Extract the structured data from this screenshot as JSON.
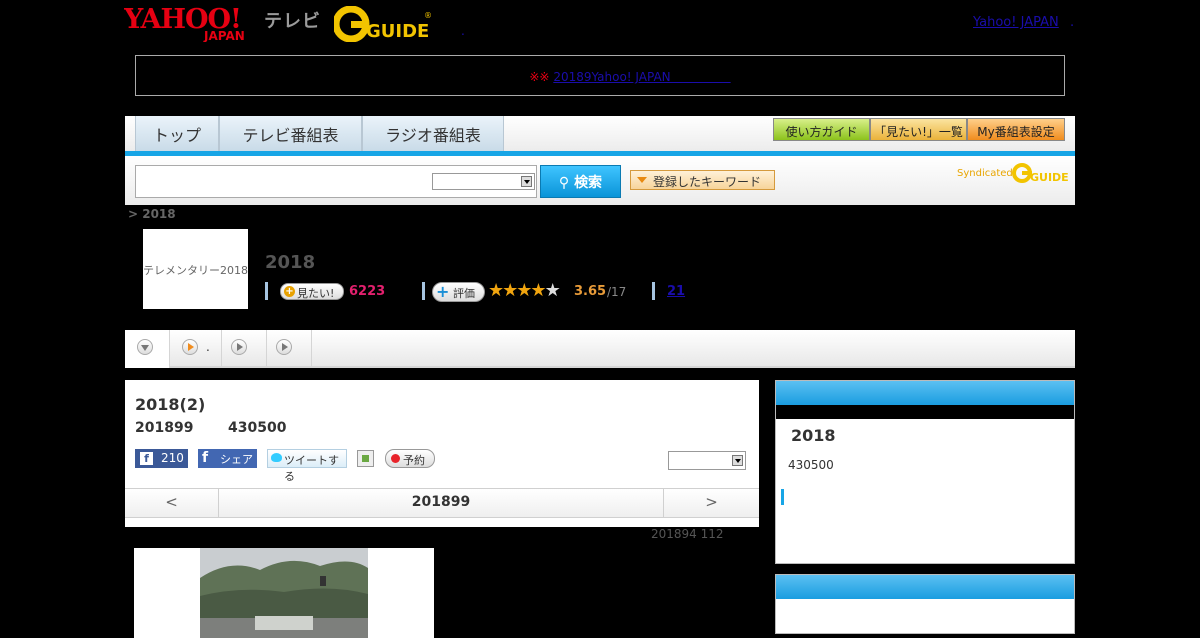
{
  "header": {
    "yahoo_logo_alt": "YAHOO! JAPAN",
    "tv_label": "テレビ",
    "gguide_logo_alt": "G-GUIDE",
    "dot": ".",
    "yahoo_link": "Yahoo! JAPAN",
    "extra_link": "."
  },
  "notice": {
    "mark": "※※",
    "link": "20189Yahoo! JAPAN　　　　　"
  },
  "nav": {
    "tabs": [
      {
        "label": "トップ"
      },
      {
        "label": "テレビ番組表"
      },
      {
        "label": "ラジオ番組表"
      }
    ],
    "buttons": [
      {
        "label": "使い方ガイド"
      },
      {
        "label": "「見たい!」一覧"
      },
      {
        "label": "My番組表設定"
      }
    ]
  },
  "search": {
    "input_value": "",
    "select_value": "",
    "button_label": "検索",
    "keyword_button": "登録したキーワード",
    "syndicated": "Syndicated"
  },
  "breadcrumb": "> 2018",
  "program": {
    "thumbnail_text": "テレメンタリー2018",
    "title": "2018",
    "want_label": "見たい!",
    "want_count": "6223",
    "rate_label": "評価",
    "stars_filled": 3.65,
    "rating": "3.65",
    "rating_total": "/17",
    "reviews_link": "21"
  },
  "subtabs": {
    "item2_text": "."
  },
  "episode": {
    "title": "2018(2)",
    "date": "201899",
    "time": "430500",
    "like_count": "210",
    "share_label": "シェア",
    "tweet_label": "ツイートする",
    "record_label": "予約",
    "select_value": "",
    "pager": {
      "prev": "<",
      "current": "201899",
      "next": ">"
    },
    "note": "201894  112"
  },
  "side": {
    "title": "2018",
    "time": "430500"
  },
  "colors": {
    "accent_blue": "#17a5e6",
    "want_pink": "#e3206e",
    "rating_orange": "#e89b39",
    "yahoo_red": "#e60012"
  }
}
